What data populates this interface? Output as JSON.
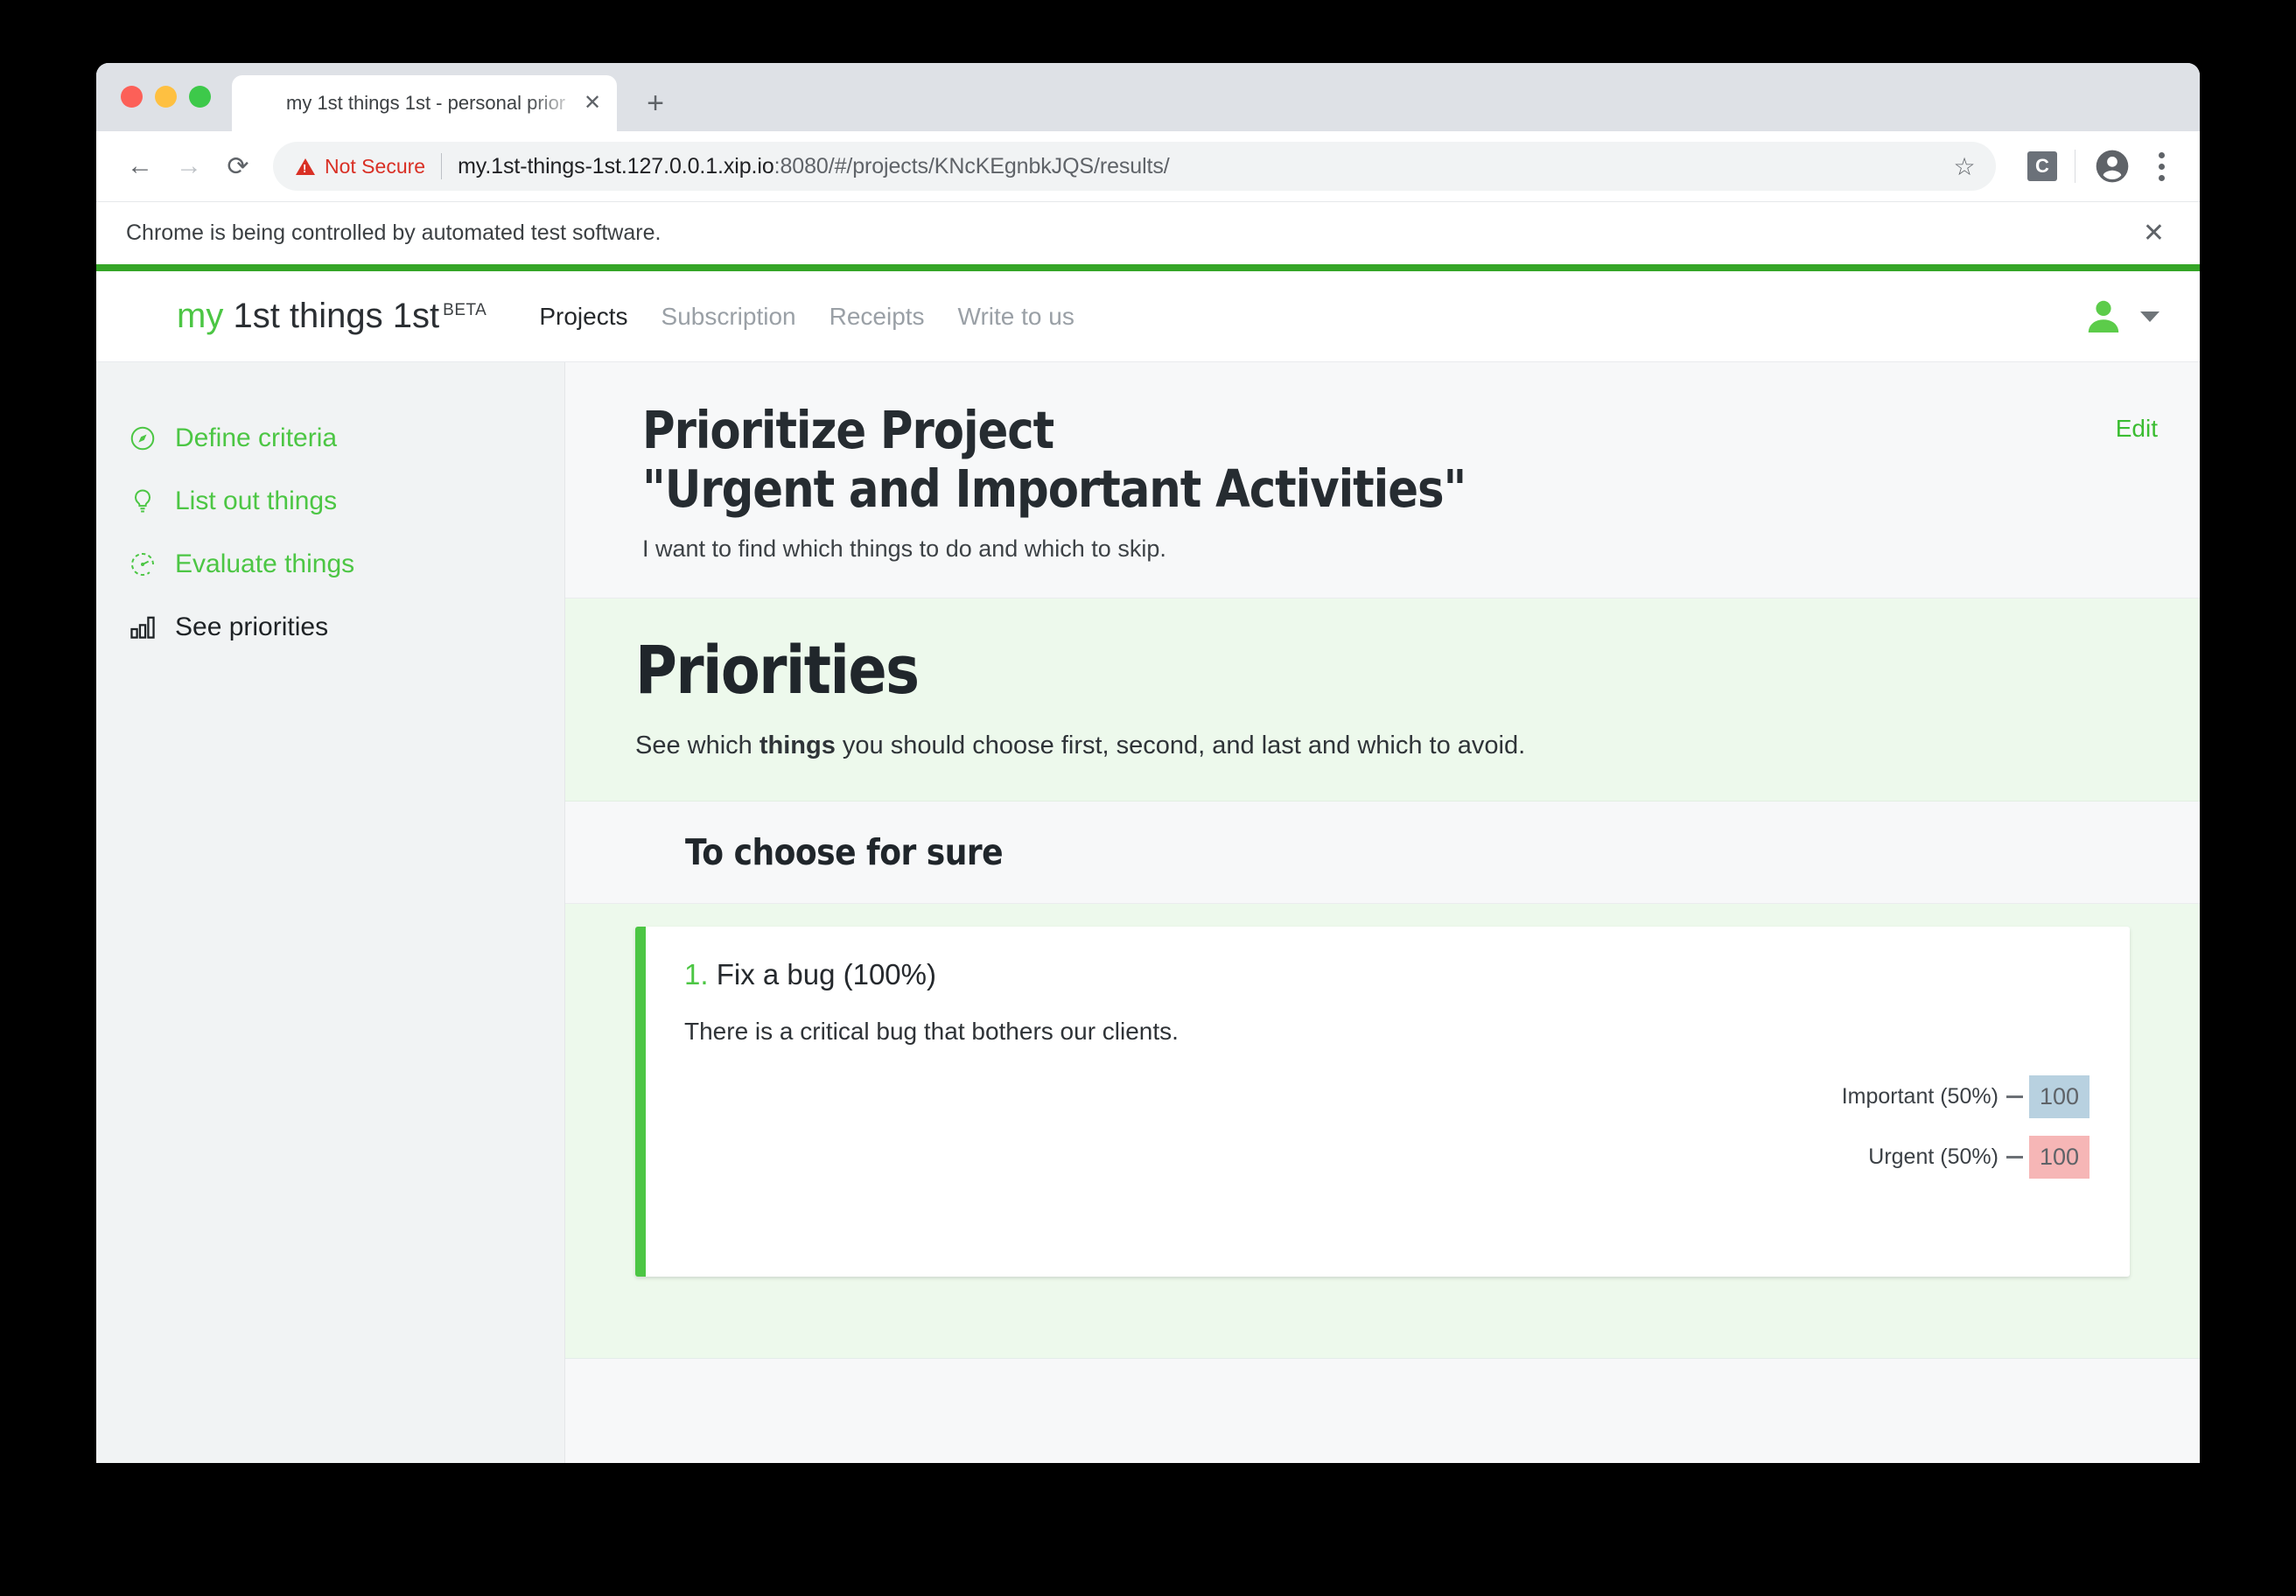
{
  "browser": {
    "tab": {
      "title": "my 1st things 1st - personal prior",
      "favicon_icon": "house-logo-icon",
      "close_icon": "close-icon"
    },
    "new_tab_label": "+",
    "traffic_lights": [
      "close",
      "minimize",
      "zoom"
    ],
    "toolbar": {
      "back_icon": "arrow-left-icon",
      "forward_icon": "arrow-right-icon",
      "reload_icon": "reload-icon",
      "security_label": "Not Secure",
      "url": "my.1st-things-1st.127.0.0.1.xip.io",
      "url_port_path": ":8080/#/projects/KNcKEgnbkJQS/results/",
      "star_icon": "star-icon",
      "extension_label": "C",
      "profile_icon": "profile-icon",
      "menu_icon": "three-dot-menu-icon"
    },
    "infobar": {
      "message": "Chrome is being controlled by automated test software.",
      "close_icon": "close-icon"
    }
  },
  "app": {
    "brand": {
      "word_my": "my",
      "word_rest": "1st things 1st",
      "beta": "BETA"
    },
    "nav": [
      {
        "label": "Projects",
        "active": true
      },
      {
        "label": "Subscription",
        "active": false
      },
      {
        "label": "Receipts",
        "active": false
      },
      {
        "label": "Write to us",
        "active": false
      }
    ],
    "account": {
      "avatar_icon": "user-avatar-icon",
      "chevron_icon": "chevron-down-icon"
    }
  },
  "sidebar": {
    "items": [
      {
        "label": "Define criteria",
        "icon": "compass-icon",
        "state": "green"
      },
      {
        "label": "List out things",
        "icon": "lightbulb-icon",
        "state": "green"
      },
      {
        "label": "Evaluate things",
        "icon": "gauge-icon",
        "state": "green"
      },
      {
        "label": "See priorities",
        "icon": "bar-chart-icon",
        "state": "active"
      }
    ]
  },
  "main": {
    "project": {
      "title_line1": "Prioritize Project",
      "title_line2": "\"Urgent and Important Activities\"",
      "description": "I want to find which things to do and which to skip.",
      "edit_label": "Edit"
    },
    "priorities": {
      "heading": "Priorities",
      "subtitle_before": "See which ",
      "subtitle_bold": "things",
      "subtitle_after": " you should choose first, second, and last and which to avoid."
    },
    "group": {
      "heading": "To choose for sure"
    },
    "results": [
      {
        "rank": "1.",
        "name": "Fix a bug (100%)",
        "description": "There is a critical bug that bothers our clients.",
        "criteria": [
          {
            "label": "Important (50%)",
            "value": "100",
            "color": "#b8d1e0"
          },
          {
            "label": "Urgent (50%)",
            "value": "100",
            "color": "#f6b6b6"
          }
        ]
      }
    ]
  },
  "colors": {
    "brand_green": "#4cc644",
    "header_strip_green": "#35a527",
    "hero_background": "#edf9ec",
    "not_secure_red": "#d93025"
  }
}
